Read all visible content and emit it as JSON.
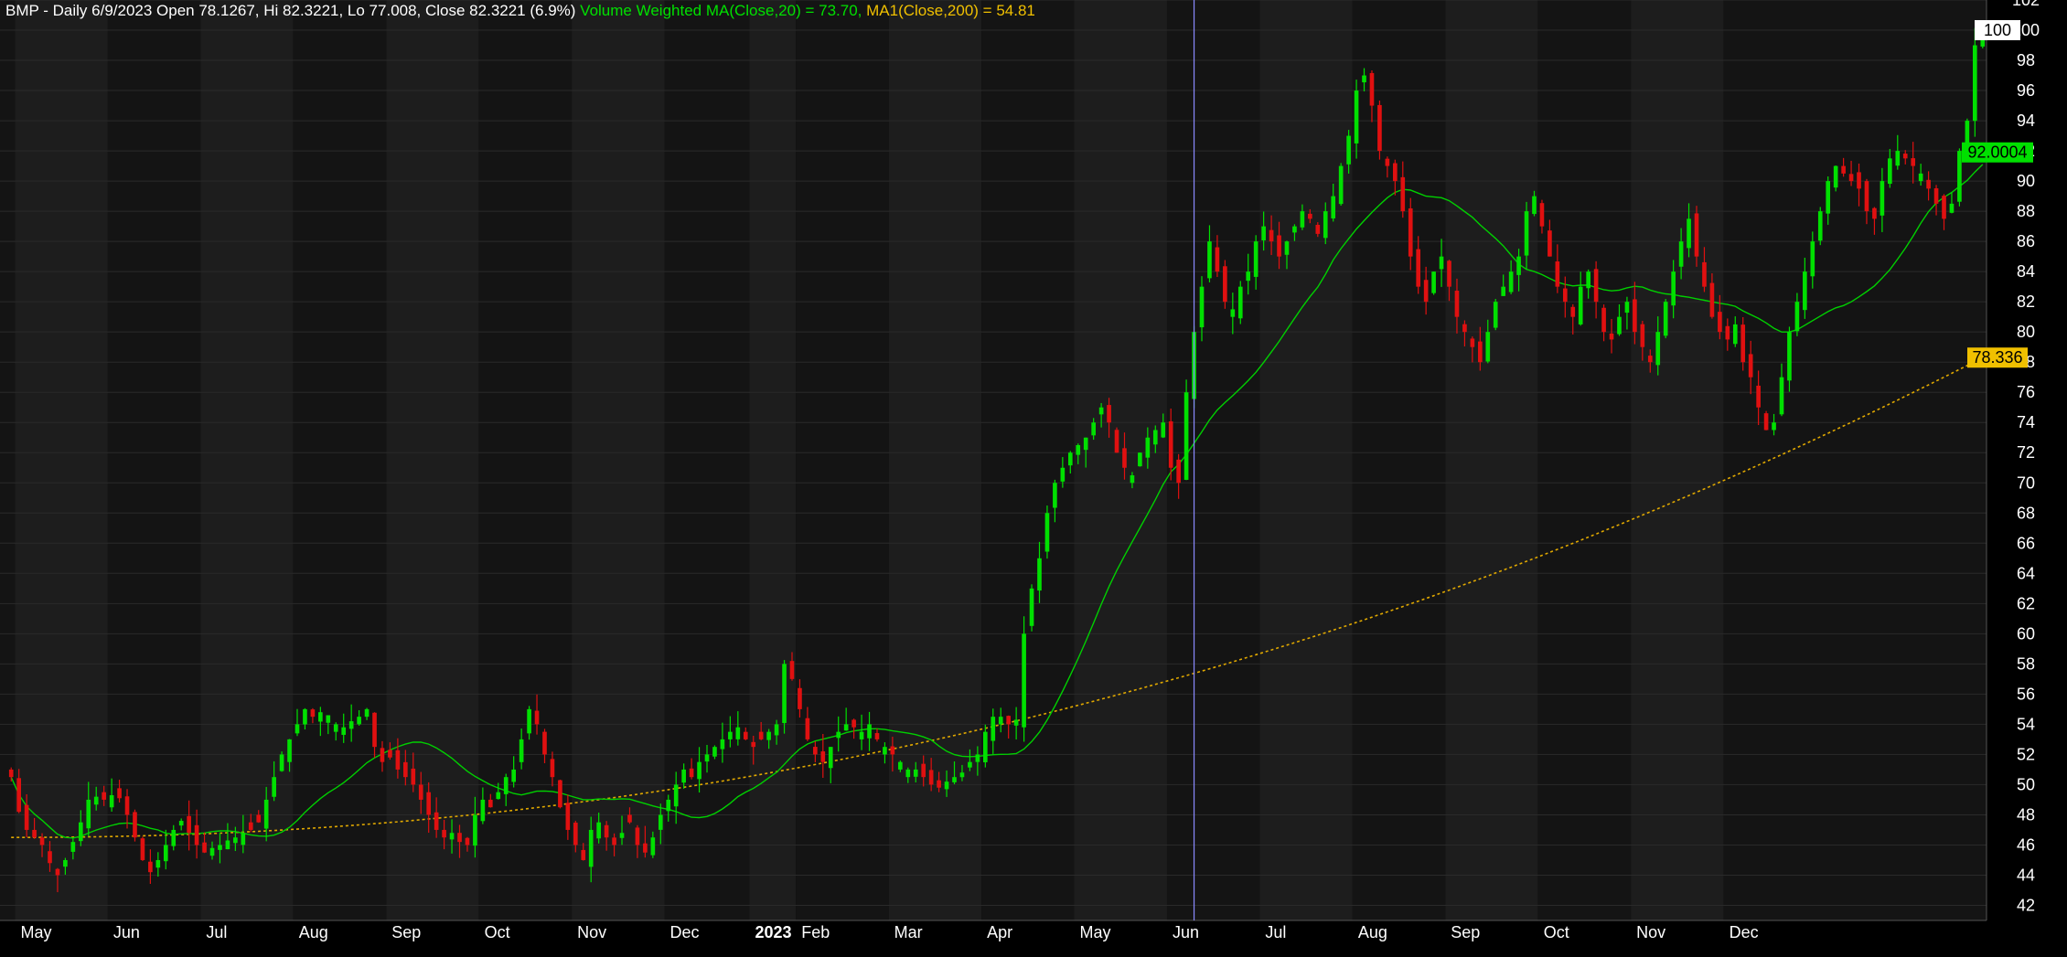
{
  "header": {
    "main": "BMP - Daily 6/9/2023 Open 78.1267, Hi 82.3221, Lo 77.008, Close 82.3221 (6.9%)",
    "vwma": "Volume Weighted MA(Close,20) = 73.70,",
    "ma200": "MA1(Close,200) = 54.81"
  },
  "colors": {
    "background": "#000000",
    "panel_dark": "#141414",
    "panel_light": "#1d1d1d",
    "up_candle": "#00e000",
    "down_candle": "#e01010",
    "vwma_line": "#00d000",
    "ma200_line": "#e0a800",
    "cursor_line": "#8a8aff",
    "label_bg_100": "#ffffff",
    "label_bg_vwma": "#00e000",
    "label_bg_ma": "#f0c000"
  },
  "price_labels": {
    "last_high": "100",
    "vwma": "92.0004",
    "ma200": "78.336"
  },
  "chart_data": {
    "type": "candlestick",
    "title": "BMP - Daily",
    "ylim": [
      41,
      102
    ],
    "y_ticks": [
      "42",
      "44",
      "46",
      "48",
      "50",
      "52",
      "54",
      "56",
      "58",
      "60",
      "62",
      "64",
      "66",
      "68",
      "70",
      "72",
      "74",
      "76",
      "78",
      "80",
      "82",
      "84",
      "86",
      "88",
      "90",
      "92",
      "94",
      "96",
      "98",
      "100",
      "102"
    ],
    "x_ticks": [
      "May",
      "Jun",
      "Jul",
      "Aug",
      "Sep",
      "Oct",
      "Nov",
      "Dec",
      "2023",
      "Feb",
      "Mar",
      "Apr",
      "May",
      "Jun",
      "Jul",
      "Aug",
      "Sep",
      "Oct",
      "Nov",
      "Dec"
    ],
    "x_tick_index": [
      1,
      13,
      25,
      37,
      49,
      61,
      73,
      85,
      96,
      102,
      114,
      126,
      138,
      150,
      162,
      174,
      186,
      198,
      210,
      222
    ],
    "cursor_index": 153,
    "bars_count": 246,
    "closes": [
      50.5,
      48.2,
      47.0,
      46.5,
      46.0,
      44.8,
      44.0,
      45.0,
      46.2,
      47.5,
      49.0,
      49.2,
      49.0,
      49.3,
      49.1,
      48.0,
      46.5,
      45.0,
      44.2,
      45.0,
      46.0,
      47.0,
      47.6,
      46.8,
      46.0,
      45.5,
      45.8,
      46.0,
      46.3,
      46.5,
      46.8,
      47.0,
      47.5,
      49.0,
      50.5,
      52.0,
      53.0,
      54.0,
      55.0,
      54.5,
      54.8,
      54.6,
      54.0,
      53.8,
      54.2,
      54.5,
      55.0,
      52.5,
      51.5,
      51.8,
      51.0,
      50.5,
      50.0,
      49.0,
      48.0,
      47.0,
      46.5,
      46.8,
      46.2,
      46.0,
      48.0,
      49.0,
      48.5,
      49.5,
      50.5,
      51.0,
      53.0,
      55.0,
      54.0,
      52.0,
      50.5,
      48.5,
      47.0,
      46.0,
      45.0,
      47.0,
      47.5,
      46.5,
      46.0,
      46.8,
      47.5,
      46.0,
      45.5,
      46.5,
      48.0,
      49.0,
      50.0,
      51.0,
      50.5,
      51.5,
      52.0,
      52.5,
      53.0,
      53.5,
      53.8,
      53.0,
      52.5,
      53.0,
      53.5,
      54.0,
      58.0,
      57.0,
      55.0,
      53.0,
      52.0,
      51.5,
      52.5,
      53.5,
      54.0,
      53.8,
      53.5,
      54.0,
      53.0,
      52.5,
      52.0,
      51.5,
      51.0,
      51.0,
      50.5,
      50.0,
      49.8,
      50.2,
      50.5,
      50.8,
      51.5,
      52.0,
      53.5,
      54.5,
      54.5,
      54.0,
      54.3,
      60.0,
      63.0,
      65.0,
      68.0,
      70.0,
      71.0,
      72.0,
      72.5,
      73.0,
      74.0,
      75.0,
      74.0,
      72.0,
      71.0,
      70.5,
      72.0,
      73.0,
      73.5,
      74.0,
      71.0,
      70.0,
      76.0,
      80.0,
      83.0,
      86.0,
      84.0,
      82.0,
      81.5,
      83.0,
      84.0,
      86.0,
      87.0,
      86.0,
      85.0,
      86.0,
      87.0,
      88.0,
      87.5,
      86.5,
      88.0,
      89.0,
      91.0,
      93.0,
      96.0,
      97.0,
      95.0,
      92.0,
      91.0,
      90.0,
      88.0,
      85.0,
      83.0,
      82.0,
      84.0,
      85.0,
      83.0,
      81.0,
      80.0,
      79.0,
      78.0,
      80.0,
      82.0,
      83.0,
      84.0,
      85.0,
      88.0,
      89.0,
      87.0,
      85.0,
      83.0,
      82.0,
      81.0,
      83.0,
      84.0,
      82.0,
      80.0,
      79.5,
      81.0,
      82.0,
      80.0,
      79.0,
      78.0,
      80.0,
      82.0,
      84.0,
      86.0,
      87.5,
      85.0,
      83.0,
      81.0,
      80.0,
      79.5,
      80.5,
      78.0,
      77.0,
      75.0,
      73.5,
      74.0,
      77.0,
      80.0,
      82.0,
      84.0,
      86.0,
      88.0,
      90.0,
      91.0,
      90.5,
      90.0,
      89.5,
      88.0,
      87.5,
      90.0,
      91.5,
      92.0,
      91.5,
      91.0,
      90.5,
      89.5,
      88.5,
      87.5,
      88.5,
      92.0,
      94.0,
      99.0,
      100.0
    ],
    "vwma_20": "computed 20-period moving average of closes",
    "ma_200": "long-term moving average rising from 46.5 to 78.3"
  }
}
